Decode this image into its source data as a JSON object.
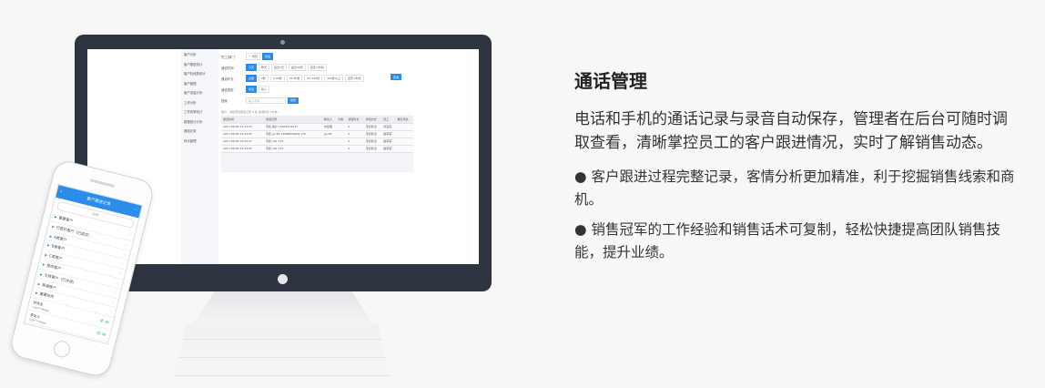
{
  "feature": {
    "title": "通话管理",
    "description": "电话和手机的通话记录与录音自动保存，管理者在后台可随时调取查看，清晰掌控员工的客户跟进情况，实时了解销售动态。",
    "points": [
      "● 客户跟进过程完整记录，客情分析更加精准，利于挖掘销售线索和商机。",
      "● 销售冠军的工作经验和销售话术可复制，轻松快捷提高团队销售技能，提升业绩。"
    ]
  },
  "desktop": {
    "sidebar": [
      {
        "label": "客户分析",
        "state": "active"
      },
      {
        "label": "客户跟进统计",
        "state": ""
      },
      {
        "label": "客户阶段数统计",
        "state": ""
      },
      {
        "label": "客户管理",
        "state": ""
      },
      {
        "label": "客户流量分析",
        "state": ""
      },
      {
        "label": "工作分析",
        "state": "active"
      },
      {
        "label": "工作效率统计",
        "state": ""
      },
      {
        "label": "数据统计分析",
        "state": ""
      },
      {
        "label": "通话记录",
        "state": "hl"
      },
      {
        "label": "拜访管理",
        "state": ""
      }
    ],
    "filters": {
      "dept_label": "员工/部门",
      "dept_value": "一 所有",
      "dept_button": "筛选",
      "date_label": "通话时间",
      "date_chips": [
        "今天",
        "昨天",
        "最近7天",
        "最近30天",
        "自定义时间"
      ],
      "duration_label": "通话时长",
      "duration_chips": [
        "全部",
        "0秒",
        "1-30秒",
        "31-60秒",
        "61-120秒",
        "120秒以上",
        "自定义时长"
      ],
      "type_label": "通话类型",
      "type_chips": [
        "呼出",
        "呼入"
      ],
      "search_label": "搜索",
      "search_placeholder": "输入号码",
      "search_button": "搜索",
      "query_button": "查询"
    },
    "summary": "统计：共检索到通话记录 5 条 通话时长 5分钟",
    "table": {
      "headers": [
        "通话时间",
        "通话记录",
        "联系人",
        "分类",
        "通话时长",
        "通话方式",
        "员工",
        "拨打状态"
      ],
      "rows": [
        [
          "2017-08-08 17:13:15",
          "手机 客户 13942274213",
          "刘经理",
          "",
          "0",
          "手机呼出",
          "何亮亮",
          ""
        ],
        [
          "2017-08-08 14:04:05",
          "手机 gx 86 13988899999 170",
          "gx 86",
          "",
          "0",
          "手机呼出",
          "殷莉莉",
          ""
        ],
        [
          "2017-08-08 14:02:27",
          "手机 191 175",
          "",
          "",
          "0",
          "手机呼出",
          "殷莉莉",
          ""
        ],
        [
          "2017-08-08 13:29:45",
          "手机 191 170",
          "",
          "",
          "0",
          "手机呼出",
          "殷莉莉",
          ""
        ]
      ]
    }
  },
  "mobile": {
    "title": "客户跟进记录",
    "back": "‹",
    "more": "⋯",
    "search_placeholder": "搜索",
    "groups": [
      "重要客户",
      "已签约客户（已成交）",
      "A类客户",
      "B类客户",
      "C类客户",
      "意向客户",
      "无效客户（已关闭）",
      "普通客户",
      "重要合作"
    ],
    "contacts": [
      {
        "name": "刘先生",
        "number": "138****6666"
      },
      {
        "name": "李女士",
        "number": "139****8888"
      }
    ],
    "group_arrow": "›",
    "group_marker": "▶",
    "contact_actions": "✆ ✉"
  }
}
